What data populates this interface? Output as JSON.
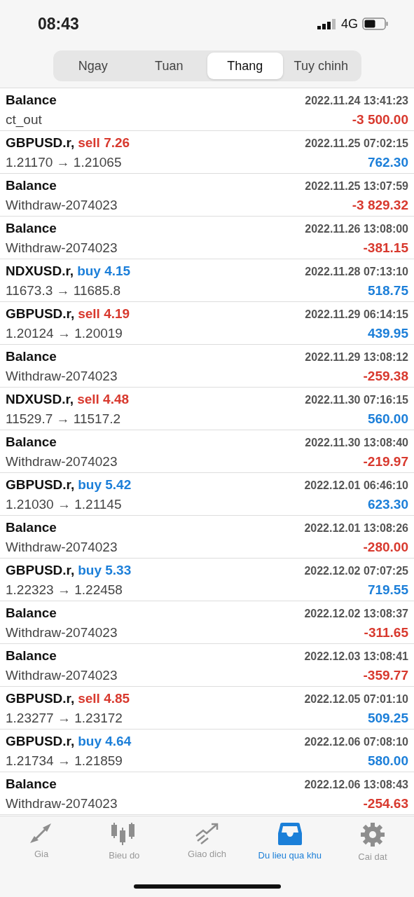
{
  "status_bar": {
    "time": "08:43",
    "network": "4G"
  },
  "period_tabs": [
    {
      "label": "Ngay",
      "selected": false
    },
    {
      "label": "Tuan",
      "selected": false
    },
    {
      "label": "Thang",
      "selected": true
    },
    {
      "label": "Tuy chinh",
      "selected": false
    }
  ],
  "history": [
    {
      "kind": "balance",
      "symbol": "Balance",
      "time": "2022.11.24 13:41:23",
      "detail": "ct_out",
      "amount": "-3 500.00",
      "negative": true
    },
    {
      "kind": "trade",
      "symbol": "GBPUSD.r,",
      "action": {
        "label": "sell 7.26",
        "kind": "sell"
      },
      "time": "2022.11.25 07:02:15",
      "detail": "1.21170 → 1.21065",
      "amount": "762.30",
      "negative": false
    },
    {
      "kind": "balance",
      "symbol": "Balance",
      "time": "2022.11.25 13:07:59",
      "detail": "Withdraw-2074023",
      "amount": "-3 829.32",
      "negative": true
    },
    {
      "kind": "balance",
      "symbol": "Balance",
      "time": "2022.11.26 13:08:00",
      "detail": "Withdraw-2074023",
      "amount": "-381.15",
      "negative": true
    },
    {
      "kind": "trade",
      "symbol": "NDXUSD.r,",
      "action": {
        "label": "buy 4.15",
        "kind": "buy"
      },
      "time": "2022.11.28 07:13:10",
      "detail": "11673.3 → 11685.8",
      "amount": "518.75",
      "negative": false
    },
    {
      "kind": "trade",
      "symbol": "GBPUSD.r,",
      "action": {
        "label": "sell 4.19",
        "kind": "sell"
      },
      "time": "2022.11.29 06:14:15",
      "detail": "1.20124 → 1.20019",
      "amount": "439.95",
      "negative": false
    },
    {
      "kind": "balance",
      "symbol": "Balance",
      "time": "2022.11.29 13:08:12",
      "detail": "Withdraw-2074023",
      "amount": "-259.38",
      "negative": true
    },
    {
      "kind": "trade",
      "symbol": "NDXUSD.r,",
      "action": {
        "label": "sell 4.48",
        "kind": "sell"
      },
      "time": "2022.11.30 07:16:15",
      "detail": "11529.7 → 11517.2",
      "amount": "560.00",
      "negative": false
    },
    {
      "kind": "balance",
      "symbol": "Balance",
      "time": "2022.11.30 13:08:40",
      "detail": "Withdraw-2074023",
      "amount": "-219.97",
      "negative": true
    },
    {
      "kind": "trade",
      "symbol": "GBPUSD.r,",
      "action": {
        "label": "buy 5.42",
        "kind": "buy"
      },
      "time": "2022.12.01 06:46:10",
      "detail": "1.21030 → 1.21145",
      "amount": "623.30",
      "negative": false
    },
    {
      "kind": "balance",
      "symbol": "Balance",
      "time": "2022.12.01 13:08:26",
      "detail": "Withdraw-2074023",
      "amount": "-280.00",
      "negative": true
    },
    {
      "kind": "trade",
      "symbol": "GBPUSD.r,",
      "action": {
        "label": "buy 5.33",
        "kind": "buy"
      },
      "time": "2022.12.02 07:07:25",
      "detail": "1.22323 → 1.22458",
      "amount": "719.55",
      "negative": false
    },
    {
      "kind": "balance",
      "symbol": "Balance",
      "time": "2022.12.02 13:08:37",
      "detail": "Withdraw-2074023",
      "amount": "-311.65",
      "negative": true
    },
    {
      "kind": "balance",
      "symbol": "Balance",
      "time": "2022.12.03 13:08:41",
      "detail": "Withdraw-2074023",
      "amount": "-359.77",
      "negative": true
    },
    {
      "kind": "trade",
      "symbol": "GBPUSD.r,",
      "action": {
        "label": "sell 4.85",
        "kind": "sell"
      },
      "time": "2022.12.05 07:01:10",
      "detail": "1.23277 → 1.23172",
      "amount": "509.25",
      "negative": false
    },
    {
      "kind": "trade",
      "symbol": "GBPUSD.r,",
      "action": {
        "label": "buy 4.64",
        "kind": "buy"
      },
      "time": "2022.12.06 07:08:10",
      "detail": "1.21734 → 1.21859",
      "amount": "580.00",
      "negative": false
    },
    {
      "kind": "balance",
      "symbol": "Balance",
      "time": "2022.12.06 13:08:43",
      "detail": "Withdraw-2074023",
      "amount": "-254.63",
      "negative": true
    }
  ],
  "tab_bar": [
    {
      "label": "Gia",
      "selected": false
    },
    {
      "label": "Bieu do",
      "selected": false
    },
    {
      "label": "Giao dich",
      "selected": false
    },
    {
      "label": "Du lieu qua khu",
      "selected": true
    },
    {
      "label": "Cai dat",
      "selected": false
    }
  ]
}
